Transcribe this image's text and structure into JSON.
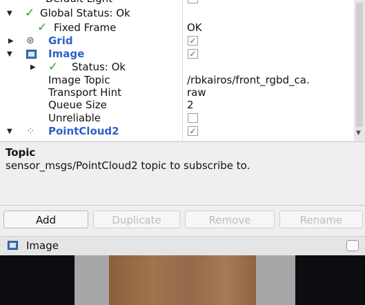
{
  "tree": {
    "cut_row": {
      "label": "Default Light"
    },
    "global_status": {
      "label": "Global Status: Ok"
    },
    "fixed_frame": {
      "label": "Fixed Frame",
      "value": "OK"
    },
    "grid": {
      "label": "Grid",
      "checked": true,
      "check_mark": "✓"
    },
    "image": {
      "label": "Image",
      "checked": true,
      "check_mark": "✓"
    },
    "image_status": {
      "label": "Status: Ok"
    },
    "image_topic": {
      "label": "Image Topic",
      "value": "/rbkairos/front_rgbd_ca."
    },
    "transport_hint": {
      "label": "Transport Hint",
      "value": "raw"
    },
    "queue_size": {
      "label": "Queue Size",
      "value": "2"
    },
    "unreliable": {
      "label": "Unreliable",
      "checked": false,
      "check_mark": ""
    },
    "pointcloud": {
      "label": "PointCloud2",
      "checked": true,
      "check_mark": "✓"
    }
  },
  "description": {
    "title": "Topic",
    "text": "sensor_msgs/PointCloud2 topic to subscribe to."
  },
  "buttons": {
    "add": "Add",
    "duplicate": "Duplicate",
    "remove": "Remove",
    "rename": "Rename"
  },
  "image_panel": {
    "title": "Image"
  },
  "icons": {
    "expanded": "▼",
    "collapsed": "▶",
    "status_ok": "✓",
    "grid": "⊛",
    "pointcloud": "⁘"
  },
  "colors": {
    "display_name_blue": "#2a62c8",
    "status_green": "#2e9a2e"
  }
}
